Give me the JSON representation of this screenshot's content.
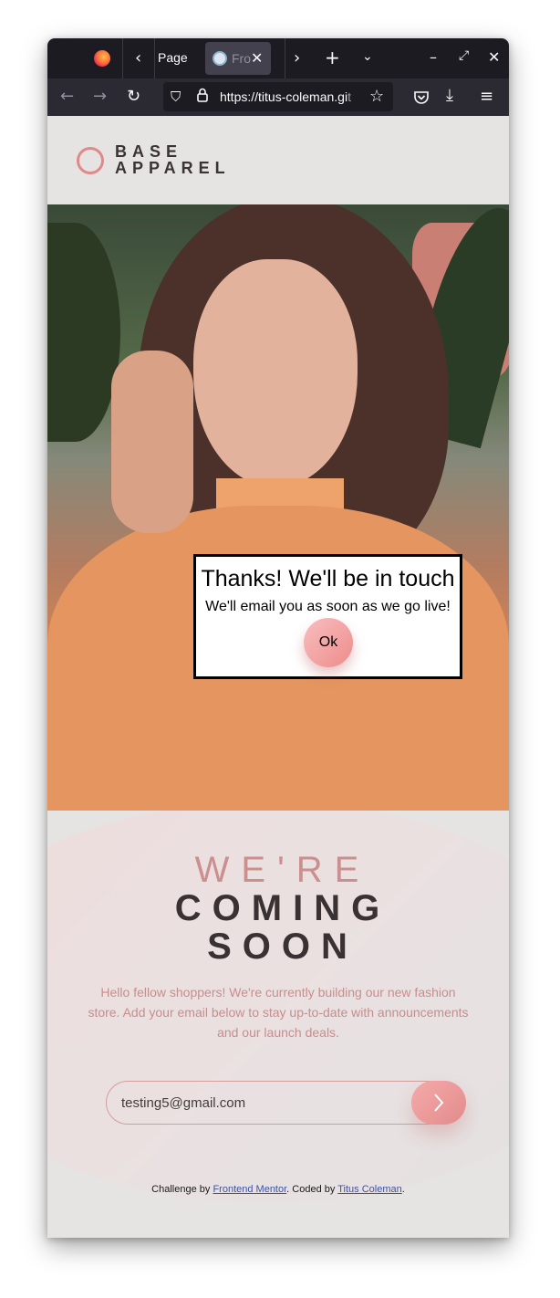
{
  "browser": {
    "tabs": [
      {
        "label": "Page"
      },
      {
        "label": "Fro",
        "active": true
      },
      {
        "label": ""
      }
    ],
    "url_main": "https://titus-coleman.gi",
    "url_rest": "t"
  },
  "site": {
    "logo_line1": "BASE",
    "logo_line2": "APPAREL",
    "brand_color": "#e0898a"
  },
  "modal": {
    "title": "Thanks! We'll be in touch",
    "text": "We'll email you as soon as we go live!",
    "ok_label": "Ok"
  },
  "main": {
    "heading_light": "WE'RE",
    "heading_dark_1": "COMING",
    "heading_dark_2": "SOON",
    "description": "Hello fellow shoppers! We're currently building our new fashion store. Add your email below to stay up-to-date with announcements and our launch deals.",
    "email_value": "testing5@gmail.com"
  },
  "footer": {
    "prefix": "Challenge by ",
    "link1": "Frontend Mentor",
    "middle": ". Coded by ",
    "link2": "Titus Coleman",
    "suffix": "."
  }
}
